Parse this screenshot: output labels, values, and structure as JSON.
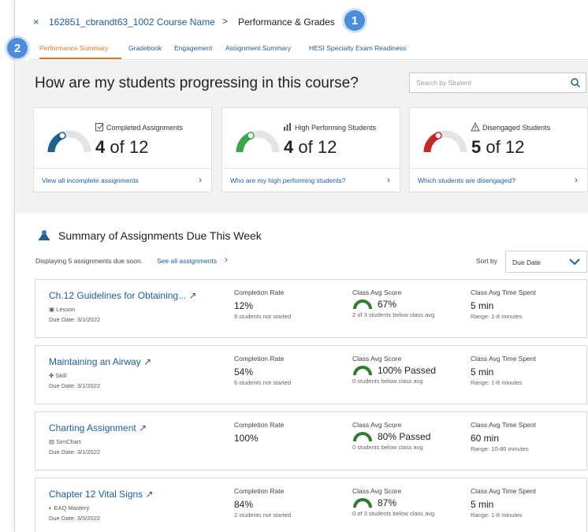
{
  "header": {
    "close_glyph": "×",
    "course": "162851_cbrandt63_1002 Course Name",
    "separator": ">",
    "current": "Performance & Grades",
    "badge1": "1",
    "badge2": "2"
  },
  "tabs": [
    {
      "label": "Performance Summary",
      "active": true
    },
    {
      "label": "Gradebook"
    },
    {
      "label": "Engagement"
    },
    {
      "label": "Assignment Summary"
    },
    {
      "label": "HESI Specialty Exam Readiness"
    }
  ],
  "summary": {
    "question": "How are my students progressing in this course?",
    "search_placeholder": "Search by Student",
    "cards": [
      {
        "title": "Completed Assignments",
        "count": "4",
        "of": "of 12",
        "link": "View all incomplete assignments",
        "color": "#1f5f8e",
        "icon": "clipboard-icon"
      },
      {
        "title": "High Performing Students",
        "count": "4",
        "of": "of 12",
        "link": "Who are my high performing students?",
        "color": "#3aa74a",
        "icon": "bar-chart-icon"
      },
      {
        "title": "Disengaged Students",
        "count": "5",
        "of": "of 12",
        "link": "Which students are disengaged?",
        "color": "#c62828",
        "icon": "warning-icon"
      }
    ]
  },
  "assignments_section": {
    "title": "Summary of Assignments Due This Week",
    "displaying": "Displaying 5 assignments due soon.",
    "see_all": "See all assignments",
    "sort_label": "Sort by",
    "sort_value": "Due Date",
    "col_labels": {
      "completion": "Completion Rate",
      "score": "Class Avg Score",
      "time": "Class Avg Time Spent"
    },
    "rows": [
      {
        "name": "Ch.12 Guidelines for Obtaining...",
        "type": "Lesson",
        "due": "Due Date: 3/1/2022",
        "completion": "12%",
        "completion_sub": "9 students not started",
        "score": "67%",
        "score_sub_red": "2",
        "score_sub": " of 3 students below class avg",
        "time": "5 min",
        "time_sub": "Range: 1-8 minutes"
      },
      {
        "name": "Maintaining an Airway",
        "type": "Skill",
        "due": "Due Date: 3/1/2022",
        "completion": "54%",
        "completion_sub": "6 students not started",
        "score": "100% Passed",
        "score_sub_red": "",
        "score_sub": "0 students below class avg",
        "time": "5 min",
        "time_sub": "Range: 1-8 minutes"
      },
      {
        "name": "Charting Assignment",
        "type": "SimChart",
        "due": "Due Date: 3/1/2022",
        "completion": "100%",
        "completion_sub": "",
        "score": "80% Passed",
        "score_sub_red": "",
        "score_sub": "0 students below class avg",
        "time": "60 min",
        "time_sub": "Range: 10-80 minutes"
      },
      {
        "name": "Chapter 12 Vital Signs",
        "type": "EAQ Mastery",
        "due": "Due Date: 3/5/2022",
        "completion": "84%",
        "completion_sub": "2 students not started",
        "score": "87%",
        "score_sub_red": "",
        "score_sub": "0 of 3 students below class avg",
        "time": "5 min",
        "time_sub": "Range: 1-8 minutes"
      }
    ]
  }
}
